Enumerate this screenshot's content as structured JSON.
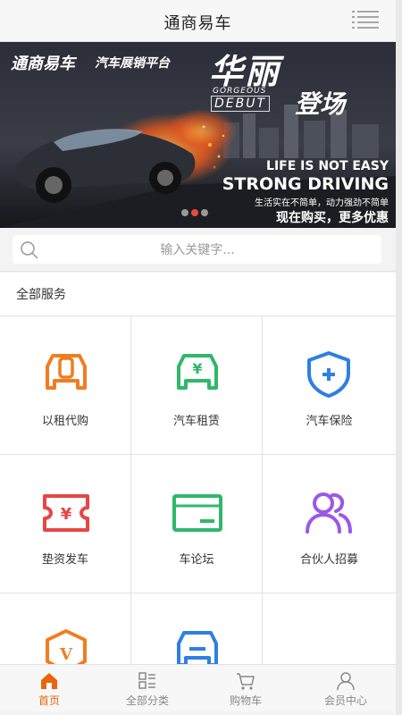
{
  "header": {
    "title": "通商易车"
  },
  "banner": {
    "logo": "通商易车",
    "platform": "汽车展销平台",
    "headline_1": "华丽",
    "gorgeous": "GORGEOUS",
    "debut": "DEBUT",
    "headline_2": "登场",
    "slogan_1": "LIFE IS NOT EASY",
    "slogan_2": "STRONG DRIVING",
    "subtitle": "生活实在不简单，动力强劲不简单",
    "cta": "现在购买，更多优惠",
    "slide_count": 3,
    "active_slide": 2
  },
  "search": {
    "placeholder": "输入关键字..."
  },
  "services": {
    "title": "全部服务",
    "items": [
      {
        "label": "以租代购",
        "icon": "car-zero-icon",
        "color": "#f07d22"
      },
      {
        "label": "汽车租赁",
        "icon": "car-yen-icon",
        "color": "#2fb86a"
      },
      {
        "label": "汽车保险",
        "icon": "shield-plus-icon",
        "color": "#2d7fe0"
      },
      {
        "label": "垫资发车",
        "icon": "yen-ticket-icon",
        "color": "#e84646"
      },
      {
        "label": "车论坛",
        "icon": "card-icon",
        "color": "#2fb86a"
      },
      {
        "label": "合伙人招募",
        "icon": "partners-icon",
        "color": "#9b58e6"
      },
      {
        "label": "",
        "icon": "badge-v-icon",
        "color": "#f07d22"
      },
      {
        "label": "",
        "icon": "car-front-icon",
        "color": "#2d7fe0"
      },
      {
        "label": "",
        "icon": "",
        "color": ""
      }
    ]
  },
  "tabbar": {
    "items": [
      {
        "label": "首页",
        "icon": "home-icon",
        "active": true
      },
      {
        "label": "全部分类",
        "icon": "category-icon",
        "active": false
      },
      {
        "label": "购物车",
        "icon": "cart-icon",
        "active": false
      },
      {
        "label": "会员中心",
        "icon": "user-icon",
        "active": false
      }
    ],
    "active_color": "#e8650c"
  }
}
